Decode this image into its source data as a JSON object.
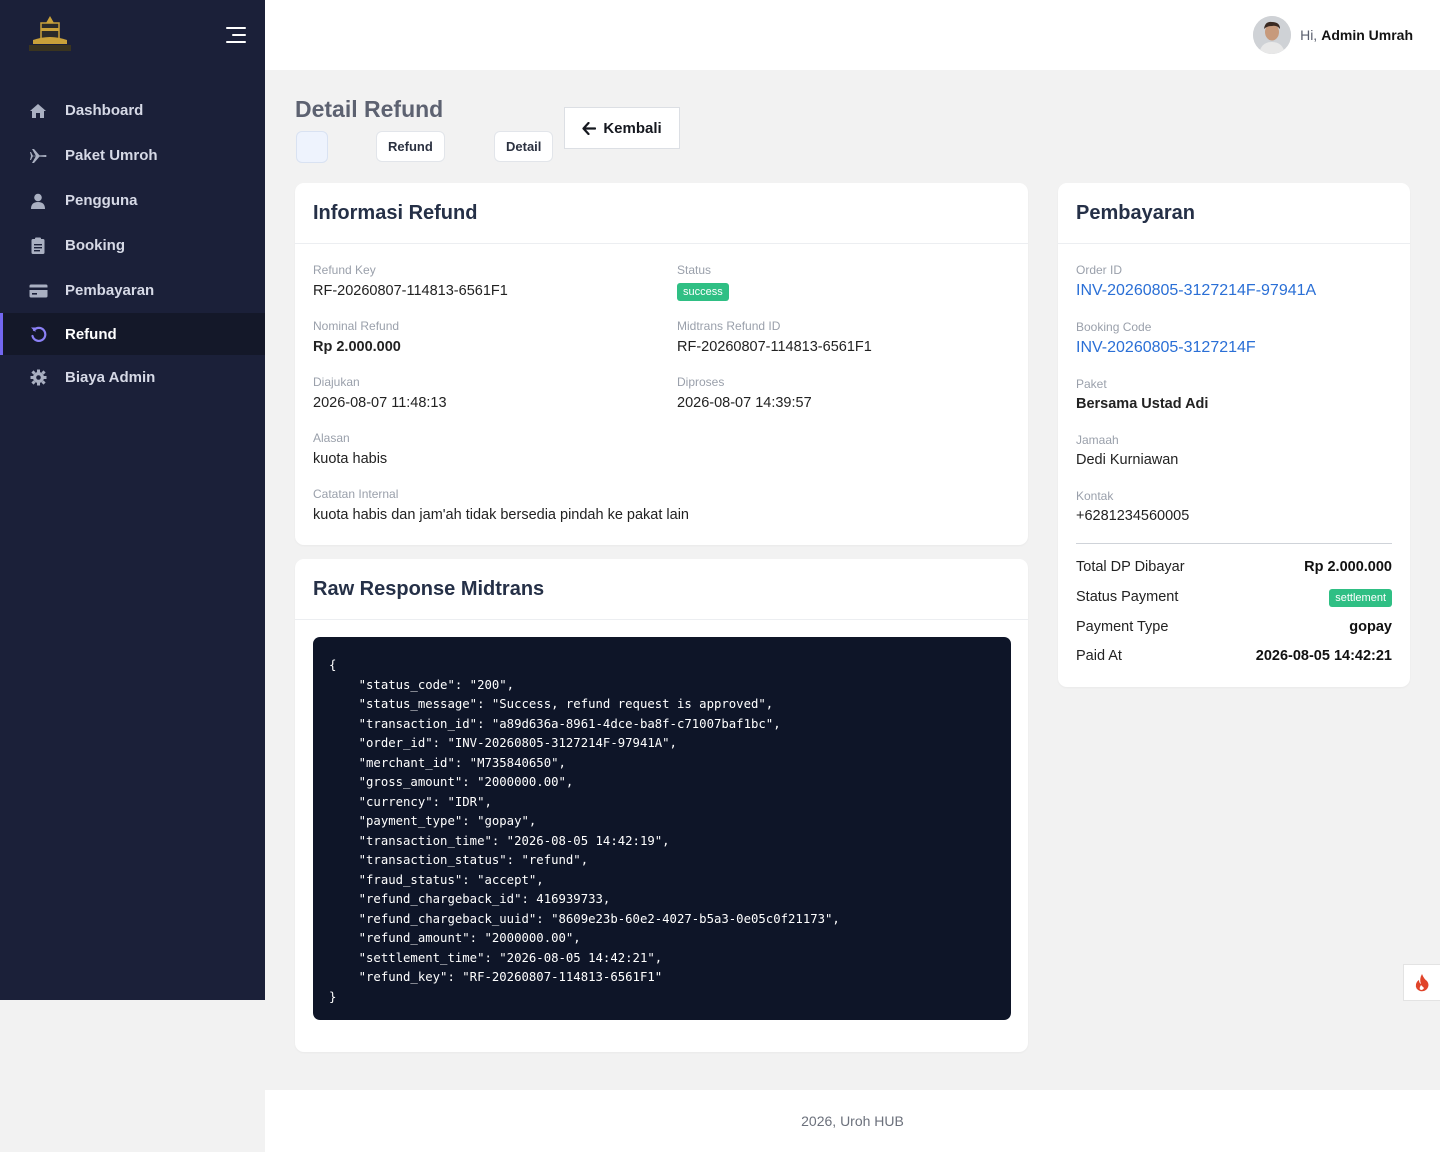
{
  "app": {
    "logo_alt": "UMROH HUB"
  },
  "sidebar": {
    "items": [
      {
        "label": "Dashboard",
        "icon": "home-icon",
        "active": false
      },
      {
        "label": "Paket Umroh",
        "icon": "plane-icon",
        "active": false
      },
      {
        "label": "Pengguna",
        "icon": "user-icon",
        "active": false
      },
      {
        "label": "Booking",
        "icon": "clipboard-icon",
        "active": false
      },
      {
        "label": "Pembayaran",
        "icon": "credit-card-icon",
        "active": false
      },
      {
        "label": "Refund",
        "icon": "undo-icon",
        "active": true
      },
      {
        "label": "Biaya Admin",
        "icon": "gear-icon",
        "active": false
      }
    ]
  },
  "topbar": {
    "greeting": "Hi,",
    "username": "Admin Umrah"
  },
  "header": {
    "title": "Detail Refund",
    "breadcrumbs": [
      "Refund",
      "Detail"
    ],
    "back_label": "Kembali"
  },
  "refund_info": {
    "title": "Informasi Refund",
    "refund_key_label": "Refund Key",
    "refund_key": "RF-20260807-114813-6561F1",
    "status_label": "Status",
    "status": "success",
    "nominal_label": "Nominal Refund",
    "nominal": "Rp 2.000.000",
    "midtrans_id_label": "Midtrans Refund ID",
    "midtrans_id": "RF-20260807-114813-6561F1",
    "diajukan_label": "Diajukan",
    "diajukan": "2026-08-07 11:48:13",
    "diproses_label": "Diproses",
    "diproses": "2026-08-07 14:39:57",
    "alasan_label": "Alasan",
    "alasan": "kuota habis",
    "catatan_label": "Catatan Internal",
    "catatan": "kuota habis dan jam'ah tidak bersedia pindah ke pakat lain"
  },
  "raw_response": {
    "title": "Raw Response Midtrans",
    "json": "{\n    \"status_code\": \"200\",\n    \"status_message\": \"Success, refund request is approved\",\n    \"transaction_id\": \"a89d636a-8961-4dce-ba8f-c71007baf1bc\",\n    \"order_id\": \"INV-20260805-3127214F-97941A\",\n    \"merchant_id\": \"M735840650\",\n    \"gross_amount\": \"2000000.00\",\n    \"currency\": \"IDR\",\n    \"payment_type\": \"gopay\",\n    \"transaction_time\": \"2026-08-05 14:42:19\",\n    \"transaction_status\": \"refund\",\n    \"fraud_status\": \"accept\",\n    \"refund_chargeback_id\": 416939733,\n    \"refund_chargeback_uuid\": \"8609e23b-60e2-4027-b5a3-0e05c0f21173\",\n    \"refund_amount\": \"2000000.00\",\n    \"settlement_time\": \"2026-08-05 14:42:21\",\n    \"refund_key\": \"RF-20260807-114813-6561F1\"\n}"
  },
  "payment": {
    "title": "Pembayaran",
    "order_id_label": "Order ID",
    "order_id": "INV-20260805-3127214F-97941A",
    "booking_code_label": "Booking Code",
    "booking_code": "INV-20260805-3127214F",
    "paket_label": "Paket",
    "paket": "Bersama Ustad Adi",
    "jamaah_label": "Jamaah",
    "jamaah": "Dedi Kurniawan",
    "kontak_label": "Kontak",
    "kontak": "+6281234560005",
    "total_dp_label": "Total DP Dibayar",
    "total_dp": "Rp 2.000.000",
    "status_payment_label": "Status Payment",
    "status_payment": "settlement",
    "payment_type_label": "Payment Type",
    "payment_type": "gopay",
    "paid_at_label": "Paid At",
    "paid_at": "2026-08-05 14:42:21"
  },
  "footer": {
    "text": "2026, Uroh HUB"
  },
  "colors": {
    "sidebar": "#1b2039",
    "accent": "#7367f0",
    "success": "#2fbf84",
    "link": "#2a6fd6",
    "code_bg": "#0e1528"
  }
}
